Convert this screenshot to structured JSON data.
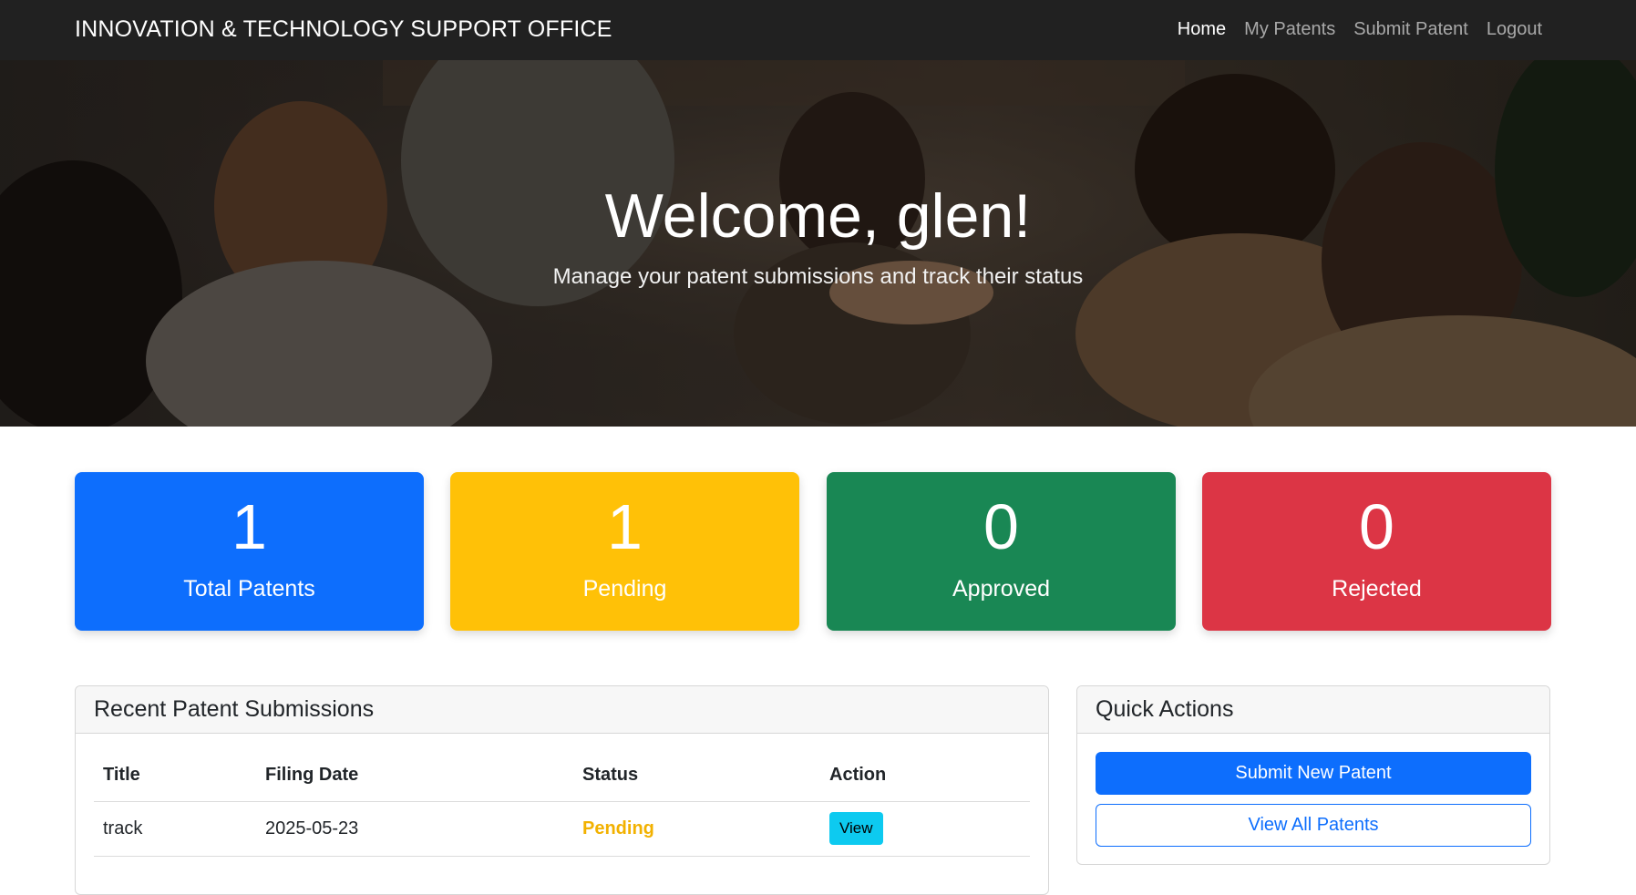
{
  "navbar": {
    "brand": "INNOVATION & TECHNOLOGY SUPPORT OFFICE",
    "links": [
      {
        "label": "Home",
        "active": true
      },
      {
        "label": "My Patents",
        "active": false
      },
      {
        "label": "Submit Patent",
        "active": false
      },
      {
        "label": "Logout",
        "active": false
      }
    ]
  },
  "hero": {
    "title": "Welcome, glen!",
    "subtitle": "Manage your patent submissions and track their status"
  },
  "stats": [
    {
      "value": "1",
      "label": "Total Patents",
      "color": "#0d6efd"
    },
    {
      "value": "1",
      "label": "Pending",
      "color": "#ffc107"
    },
    {
      "value": "0",
      "label": "Approved",
      "color": "#198754"
    },
    {
      "value": "0",
      "label": "Rejected",
      "color": "#dc3545"
    }
  ],
  "recent": {
    "title": "Recent Patent Submissions",
    "columns": [
      "Title",
      "Filing Date",
      "Status",
      "Action"
    ],
    "rows": [
      {
        "title": "track",
        "filing_date": "2025-05-23",
        "status": "Pending",
        "action": "View"
      }
    ]
  },
  "quick_actions": {
    "title": "Quick Actions",
    "submit_label": "Submit New Patent",
    "view_all_label": "View All Patents"
  },
  "colors": {
    "navbar_bg": "#212121",
    "primary": "#0d6efd",
    "info": "#0dcaf0",
    "pending_text": "#f2b100"
  }
}
